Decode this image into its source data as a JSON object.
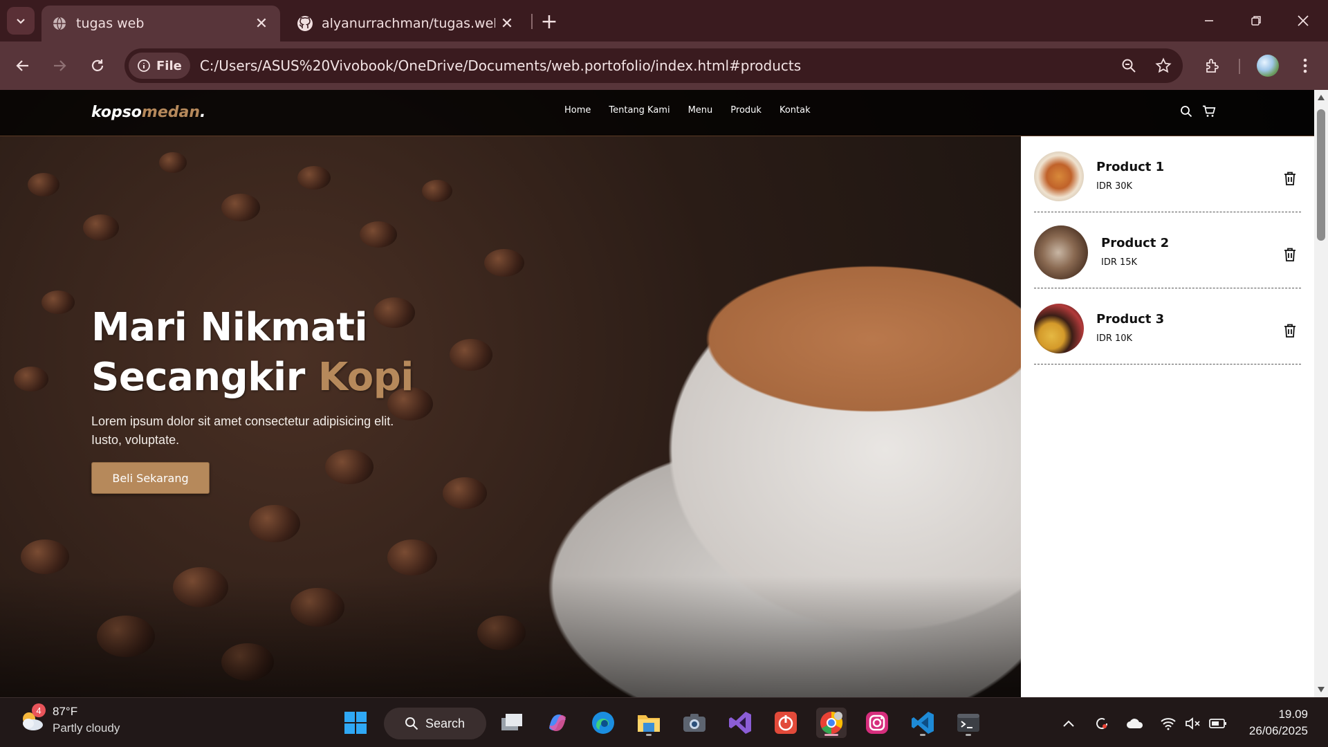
{
  "browser": {
    "tabs": [
      {
        "title": "tugas web",
        "active": true
      },
      {
        "title": "alyanurrachman/tugas.web.port",
        "active": false
      }
    ],
    "omnibox": {
      "chip_label": "File",
      "url": "C:/Users/ASUS%20Vivobook/OneDrive/Documents/web.portofolio/index.html#products"
    }
  },
  "site": {
    "logo": {
      "main": "kopso",
      "accent": "medan",
      "dot": "."
    },
    "menu": [
      "Home",
      "Tentang Kami",
      "Menu",
      "Produk",
      "Kontak"
    ],
    "hero": {
      "title_line1": "Mari Nikmati",
      "title_line2_a": "Secangkir ",
      "title_line2_b": "Kopi",
      "text": "Lorem ipsum dolor sit amet consectetur adipisicing elit. Iusto, voluptate.",
      "cta": "Beli Sekarang"
    },
    "cart": [
      {
        "name": "Product 1",
        "price": "IDR 30K"
      },
      {
        "name": "Product 2",
        "price": "IDR 15K"
      },
      {
        "name": "Product 3",
        "price": "IDR 10K"
      }
    ]
  },
  "taskbar": {
    "weather": {
      "temp": "87°F",
      "condition": "Partly cloudy",
      "badge": "4"
    },
    "search_label": "Search",
    "clock": {
      "time": "19.09",
      "date": "26/06/2025"
    }
  },
  "colors": {
    "accent": "#b6895b",
    "chrome": "#58353a",
    "tabbar": "#3a1b1f"
  }
}
